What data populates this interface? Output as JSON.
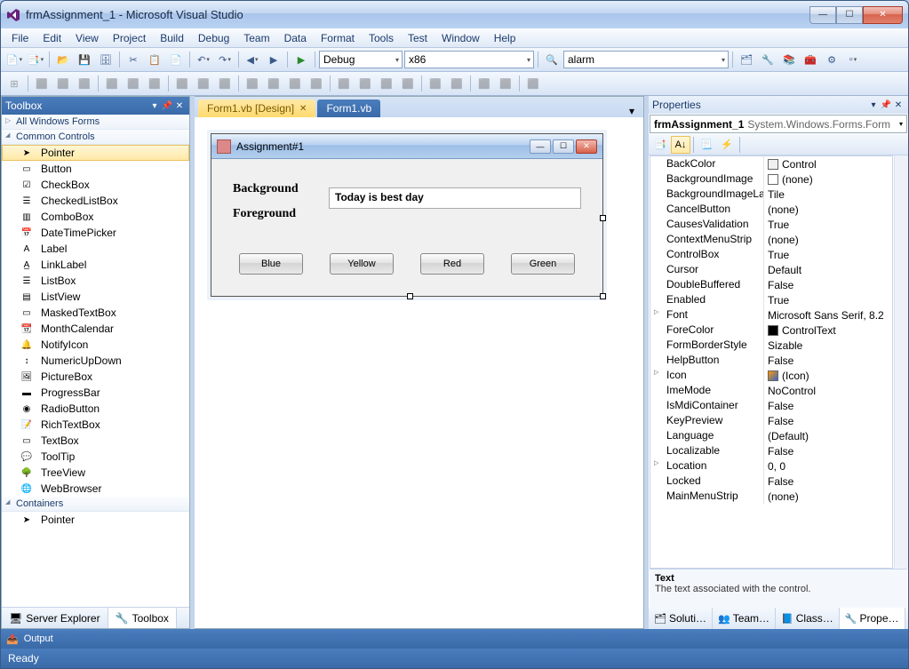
{
  "window": {
    "title": "frmAssignment_1 - Microsoft Visual Studio"
  },
  "menu": [
    "File",
    "Edit",
    "View",
    "Project",
    "Build",
    "Debug",
    "Team",
    "Data",
    "Format",
    "Tools",
    "Test",
    "Window",
    "Help"
  ],
  "toolbar1": {
    "config": "Debug",
    "platform": "x86",
    "find": "alarm"
  },
  "tabs": {
    "active": "Form1.vb [Design]",
    "inactive": "Form1.vb"
  },
  "toolbox": {
    "title": "Toolbox",
    "groups": {
      "g1": "All Windows Forms",
      "g2": "Common Controls",
      "g3": "Containers"
    },
    "items": [
      "Pointer",
      "Button",
      "CheckBox",
      "CheckedListBox",
      "ComboBox",
      "DateTimePicker",
      "Label",
      "LinkLabel",
      "ListBox",
      "ListView",
      "MaskedTextBox",
      "MonthCalendar",
      "NotifyIcon",
      "NumericUpDown",
      "PictureBox",
      "ProgressBar",
      "RadioButton",
      "RichTextBox",
      "TextBox",
      "ToolTip",
      "TreeView",
      "WebBrowser"
    ],
    "container_items": [
      "Pointer"
    ],
    "footer": {
      "server": "Server Explorer",
      "toolbox": "Toolbox"
    }
  },
  "form": {
    "title": "Assignment#1",
    "label_bg": "Background",
    "label_fg": "Foreground",
    "textbox": "Today is best day",
    "buttons": [
      "Blue",
      "Yellow",
      "Red",
      "Green"
    ]
  },
  "properties": {
    "title": "Properties",
    "object": "frmAssignment_1  System.Windows.Forms.Form",
    "rows": [
      {
        "n": "BackColor",
        "v": "Control",
        "sw": "#f0f0f0"
      },
      {
        "n": "BackgroundImage",
        "v": "(none)",
        "sw": "#ffffff"
      },
      {
        "n": "BackgroundImageLa",
        "v": "Tile"
      },
      {
        "n": "CancelButton",
        "v": "(none)"
      },
      {
        "n": "CausesValidation",
        "v": "True"
      },
      {
        "n": "ContextMenuStrip",
        "v": "(none)"
      },
      {
        "n": "ControlBox",
        "v": "True"
      },
      {
        "n": "Cursor",
        "v": "Default"
      },
      {
        "n": "DoubleBuffered",
        "v": "False"
      },
      {
        "n": "Enabled",
        "v": "True"
      },
      {
        "n": "Font",
        "v": "Microsoft Sans Serif, 8.2",
        "exp": true
      },
      {
        "n": "ForeColor",
        "v": "ControlText",
        "sw": "#000000"
      },
      {
        "n": "FormBorderStyle",
        "v": "Sizable"
      },
      {
        "n": "HelpButton",
        "v": "False"
      },
      {
        "n": "Icon",
        "v": "(Icon)",
        "sw": "icon",
        "exp": true
      },
      {
        "n": "ImeMode",
        "v": "NoControl"
      },
      {
        "n": "IsMdiContainer",
        "v": "False"
      },
      {
        "n": "KeyPreview",
        "v": "False"
      },
      {
        "n": "Language",
        "v": "(Default)"
      },
      {
        "n": "Localizable",
        "v": "False"
      },
      {
        "n": "Location",
        "v": "0, 0",
        "exp": true
      },
      {
        "n": "Locked",
        "v": "False"
      },
      {
        "n": "MainMenuStrip",
        "v": "(none)"
      }
    ],
    "desc": {
      "name": "Text",
      "text": "The text associated with the control."
    },
    "footer": [
      "Soluti…",
      "Team…",
      "Class…",
      "Prope…"
    ]
  },
  "output": "Output",
  "status": "Ready"
}
